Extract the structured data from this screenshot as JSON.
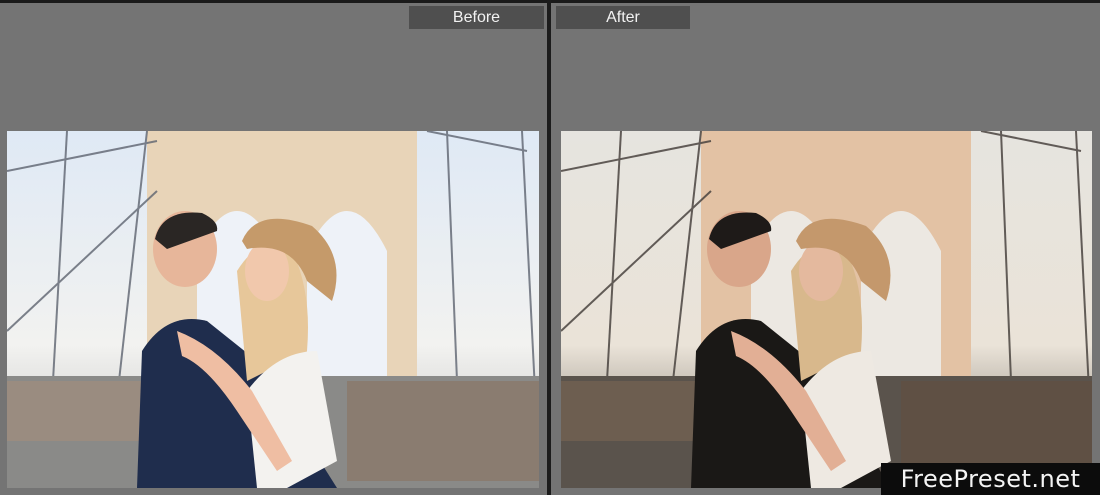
{
  "compare": {
    "before_label": "Before",
    "after_label": "After"
  },
  "watermark": {
    "text": "FreePreset.net"
  },
  "colors": {
    "panel_bg": "#747474",
    "label_bg": "#4f4f4f",
    "divider": "#1c1c1c",
    "watermark_bg": "#0c0c0c"
  }
}
